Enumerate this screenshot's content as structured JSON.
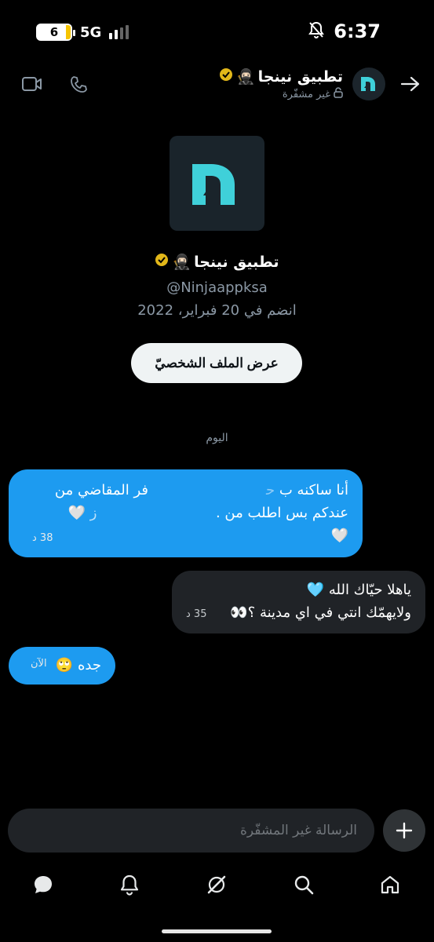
{
  "status_bar": {
    "battery_level": "6",
    "network": "5G",
    "time": "6:37"
  },
  "header": {
    "title": "تطبيق نينجا",
    "title_emoji": "🥷🏻",
    "subtitle": "غير مشفّرة"
  },
  "profile": {
    "name": "تطبيق نينجا",
    "name_emoji": "🥷🏻",
    "handle": "@Ninjaappksa",
    "joined": "انضم في 20 فبراير، 2022",
    "view_profile_label": "عرض الملف الشخصيّ"
  },
  "day_separator": "اليوم",
  "messages": [
    {
      "lines": [
        "أنا ساكنه ب",
        "فر المقاضي من",
        "عندكم بس اطلب من",
        "🤍"
      ],
      "trail": "🤍",
      "time": "38 د"
    },
    {
      "lines": [
        "ياهلا حيّاك الله 🩵",
        "ولايهمّك انتي في اي مدينة ؟👀"
      ],
      "time": "35 د"
    },
    {
      "lines": [
        "جده 🙄"
      ],
      "time": "الآن"
    }
  ],
  "composer": {
    "placeholder": "الرسالة غير المشفّرة"
  },
  "colors": {
    "accent": "#1d9bf0",
    "bubble_dark": "#202327",
    "background": "#000000",
    "brand": "#3fd0d9"
  }
}
